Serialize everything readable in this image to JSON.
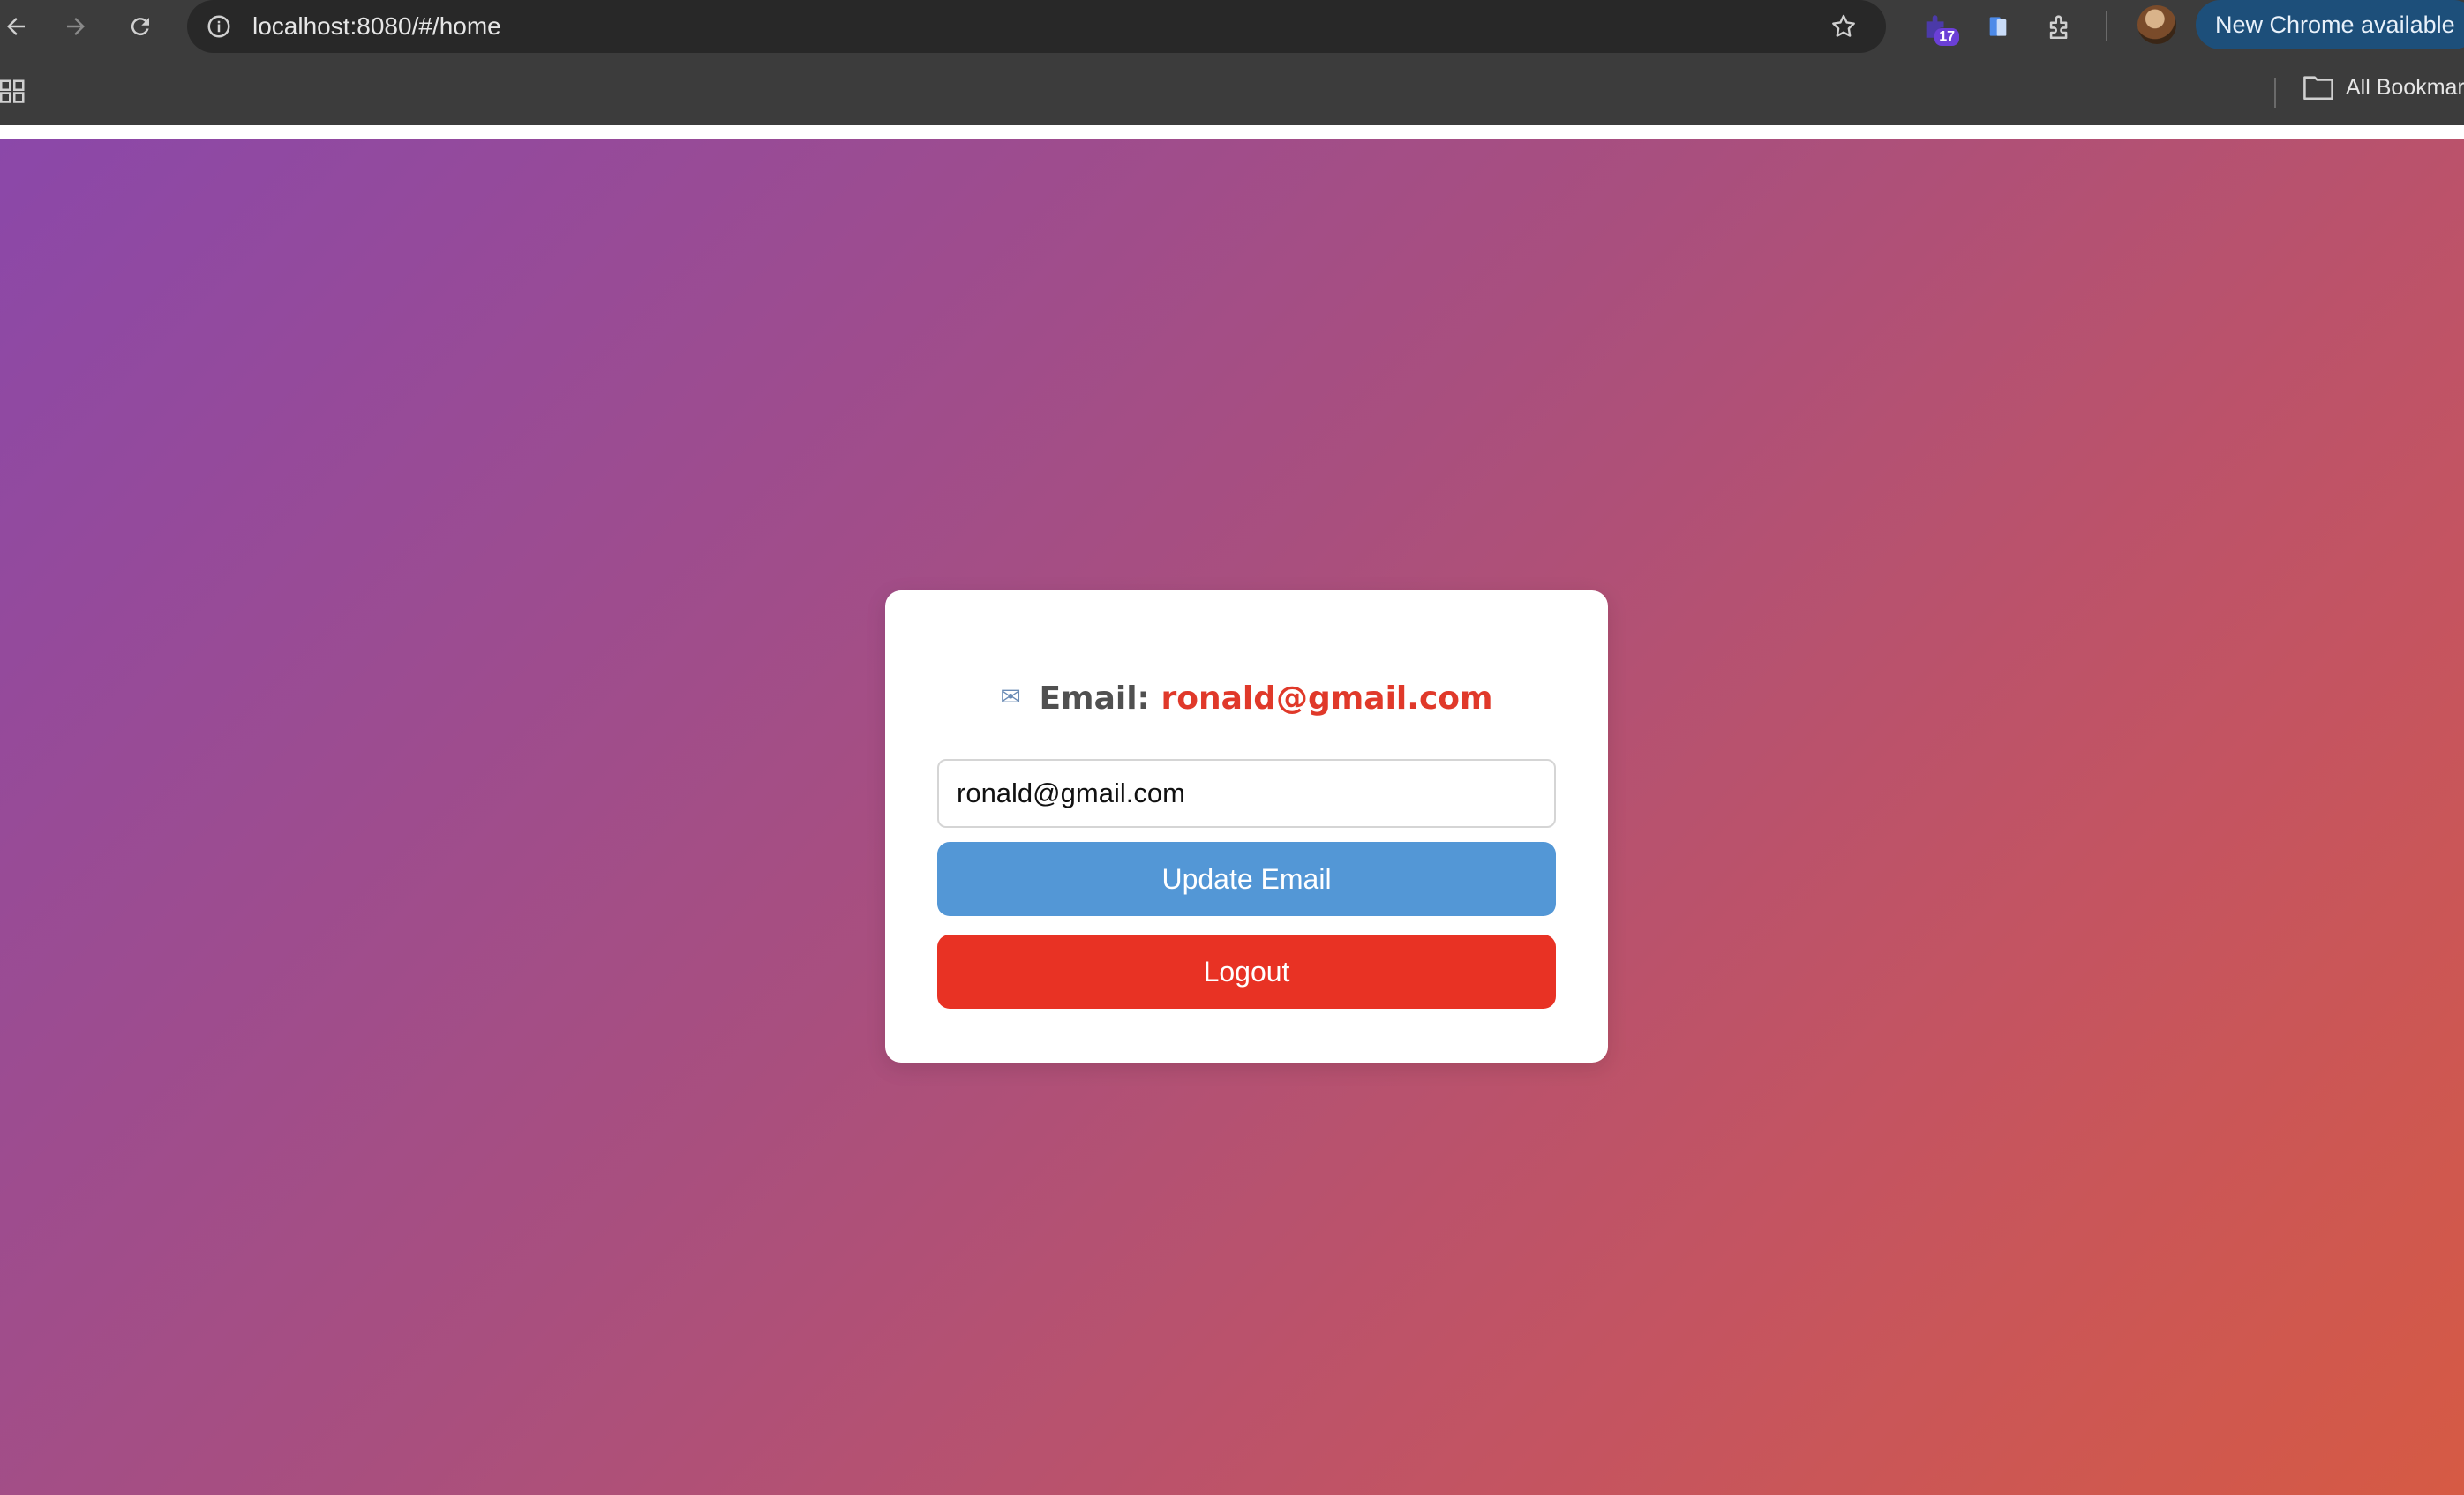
{
  "browser": {
    "url": "localhost:8080/#/home",
    "extension_badge": "17",
    "update_label": "New Chrome available",
    "bookmarks_label": "All Bookmarks"
  },
  "card": {
    "heading_label": "Email:",
    "heading_value": "ronald@gmail.com",
    "heading_icon": "envelope-icon",
    "email_input_value": "ronald@gmail.com",
    "update_button_label": "Update Email",
    "logout_button_label": "Logout"
  },
  "colors": {
    "gradient_start": "#8b48a9",
    "gradient_end": "#d65a44",
    "update_button": "#5397d6",
    "logout_button": "#e83224",
    "email_value": "#e0392a"
  }
}
